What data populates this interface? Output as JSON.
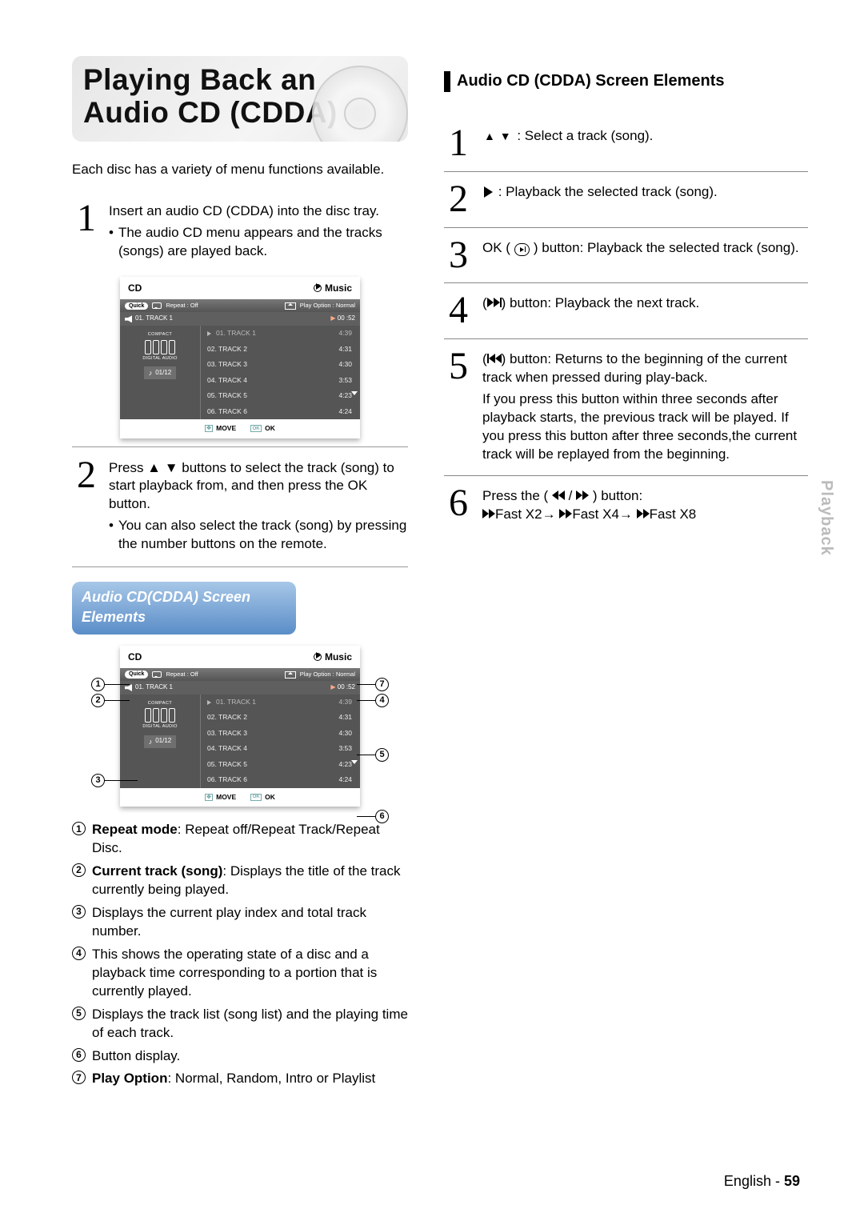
{
  "left": {
    "title": "Playing Back an Audio CD (CDDA)",
    "intro": "Each disc has a variety of menu functions available.",
    "step1": {
      "main": "Insert an audio CD (CDDA) into the disc tray.",
      "bullet": "The audio CD menu appears and the tracks (songs) are played back."
    },
    "step2": {
      "main": "Press ▲ ▼ buttons to select the track (song) to start playback from, and then press the OK button.",
      "bullet": "You can also select the track (song) by pressing the number buttons on the remote."
    },
    "screen_heading": "Audio CD(CDDA) Screen Elements",
    "legend": {
      "1": {
        "bold": "Repeat mode",
        "rest": ": Repeat off/Repeat Track/Repeat Disc."
      },
      "2": {
        "bold": "Current track (song)",
        "rest": ": Displays the title of the track currently being played."
      },
      "3": {
        "rest": "Displays the current play index and total track number."
      },
      "4": {
        "rest": "This shows the operating state of a disc and a playback time corresponding to a portion that is currently played."
      },
      "5": {
        "rest": "Displays the track list (song list) and the playing time of each track."
      },
      "6": {
        "rest": "Button display."
      },
      "7": {
        "bold": "Play Option",
        "rest": ": Normal, Random, Intro or Playlist"
      }
    }
  },
  "right": {
    "heading": "Audio CD (CDDA) Screen Elements",
    "s1": "▲ ▼  : Select a track (song).",
    "s2": " : Playback the selected track (song).",
    "s3a": "OK (",
    "s3b": ") button: Playback the selected track (song).",
    "s4b": ") button: Playback the next track.",
    "s5b": ") button: Returns to the beginning of the current track when pressed during play-back.",
    "s5c": "If you press this button within three seconds after playback starts, the previous track will be played. If you press this button after three seconds,the current track will be replayed from the beginning.",
    "s6a": "Press the (",
    "s6b": ") button:",
    "s6c": "Fast X2→",
    "s6d": "Fast X4→",
    "s6e": "Fast X8"
  },
  "cd": {
    "hdr_left": "CD",
    "hdr_right": "Music",
    "quick": "Quick",
    "repeat_label": "Repeat : Off",
    "playoption": "Play Option : Normal",
    "current_track": "01. TRACK 1",
    "timer": "00 :52",
    "compact": "COMPACT",
    "digital": "DIGITAL AUDIO",
    "playindex": "01/12",
    "tracks": [
      {
        "name": "01. TRACK 1",
        "time": "4:39",
        "sel": true
      },
      {
        "name": "02. TRACK 2",
        "time": "4:31"
      },
      {
        "name": "03. TRACK 3",
        "time": "4:30"
      },
      {
        "name": "04. TRACK 4",
        "time": "3:53"
      },
      {
        "name": "05. TRACK 5",
        "time": "4:23"
      },
      {
        "name": "06. TRACK 6",
        "time": "4:24"
      }
    ],
    "move": "MOVE",
    "ok": "OK"
  },
  "side_tag": "Playback",
  "footer_lang": "English - ",
  "footer_page": "59"
}
